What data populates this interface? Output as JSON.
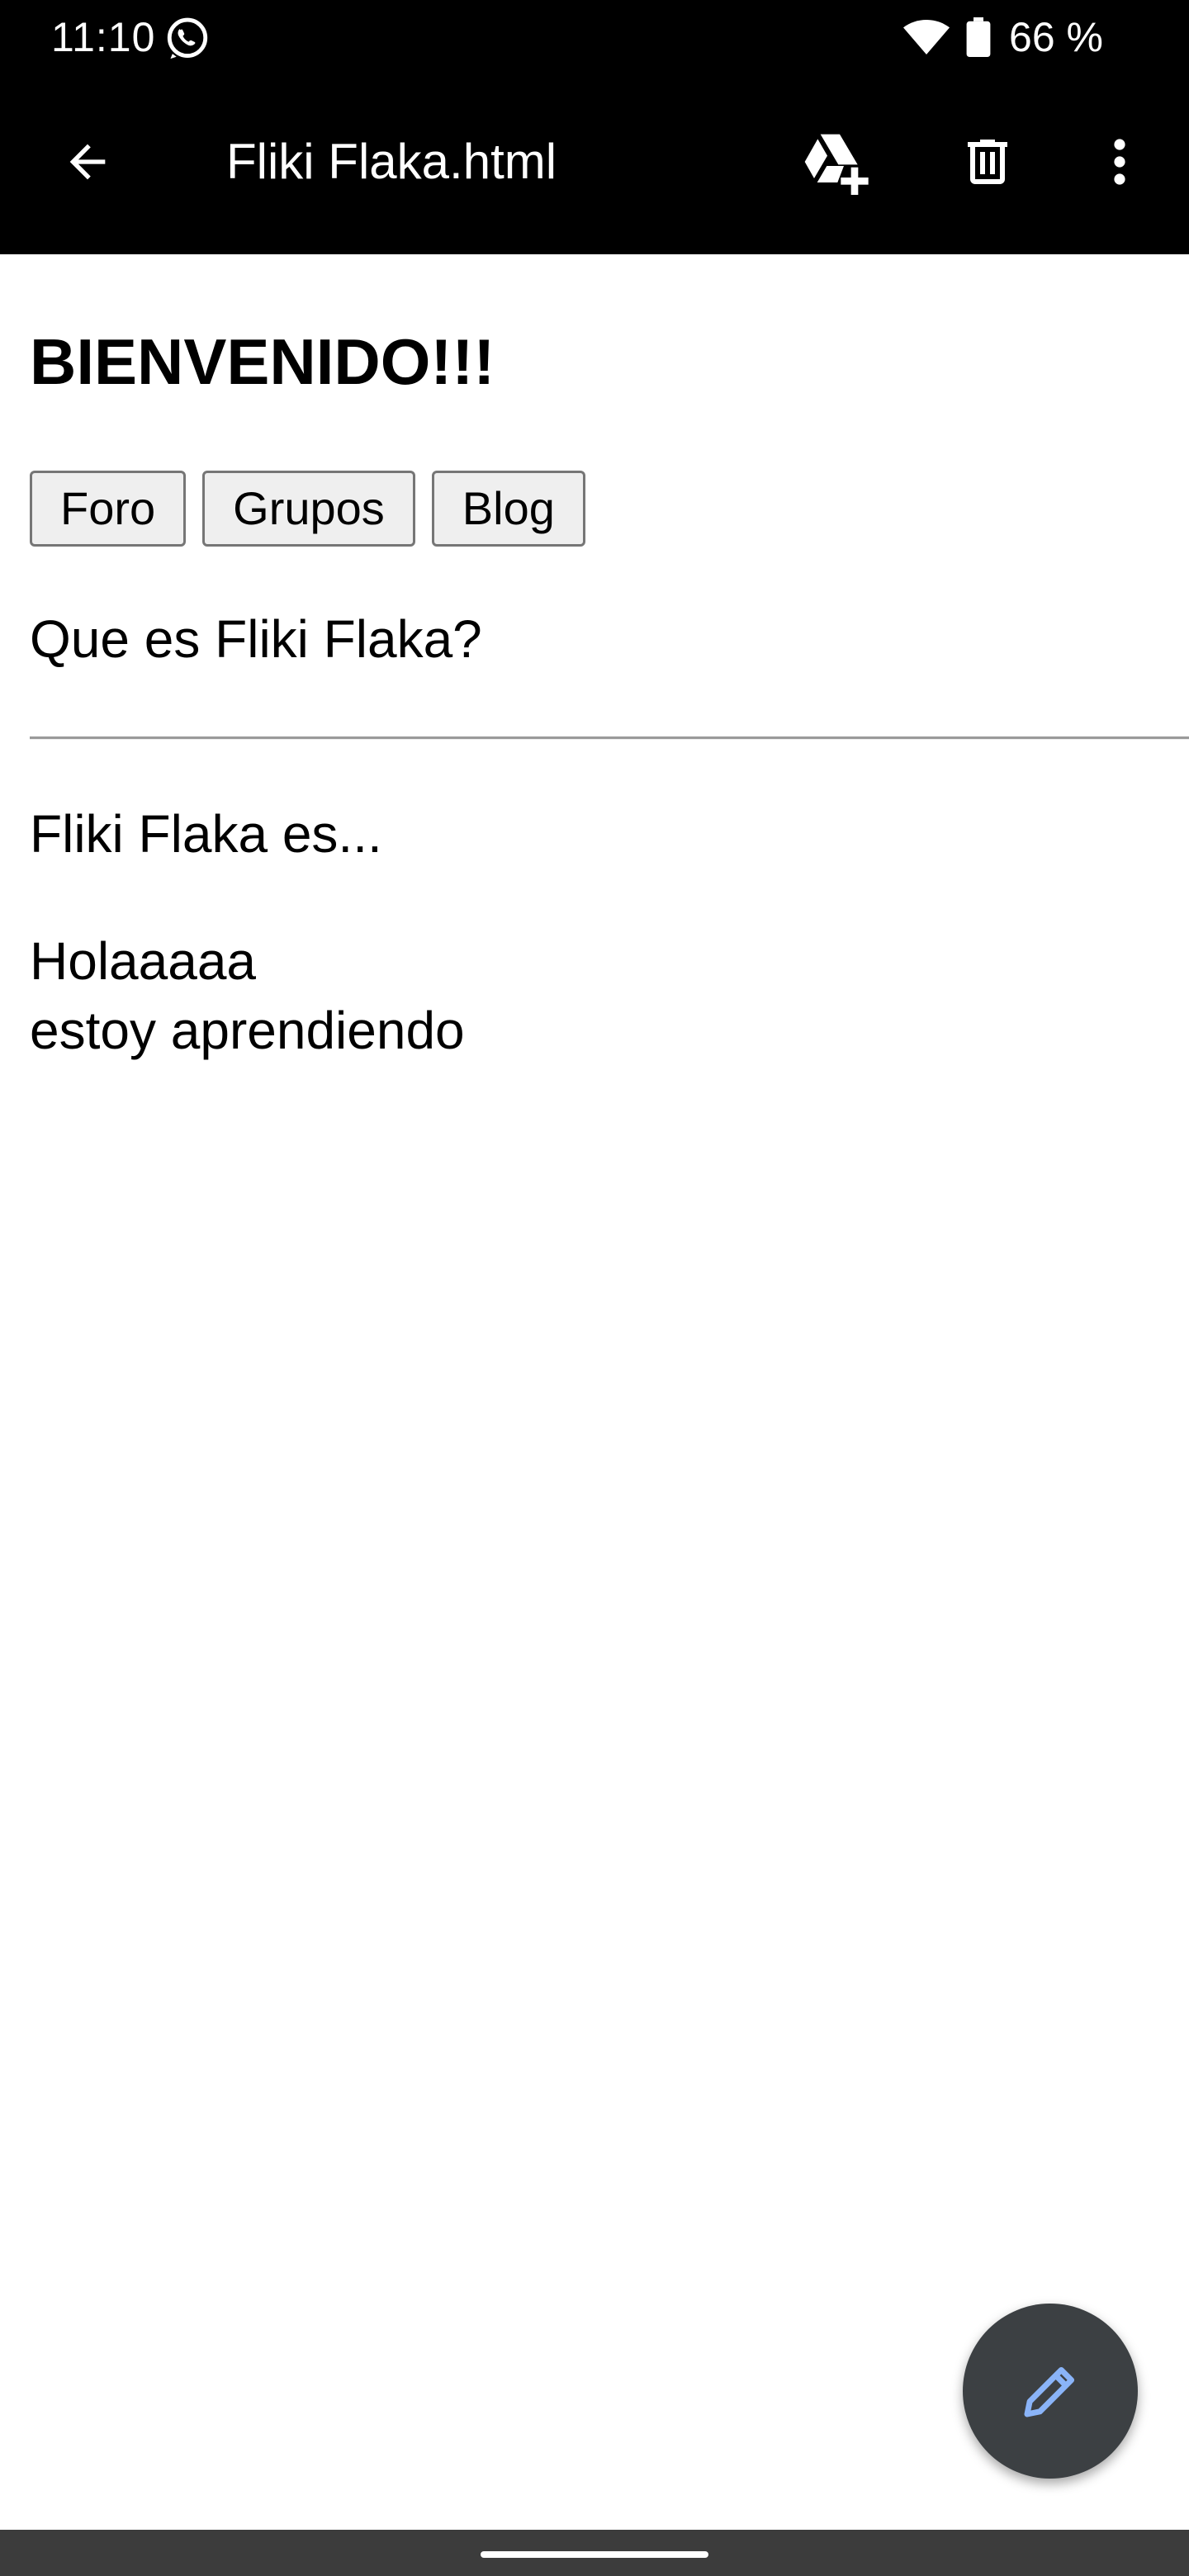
{
  "status_bar": {
    "time": "11:10",
    "battery": "66 %",
    "icons": [
      "whatsapp-icon",
      "wifi-icon",
      "battery-icon"
    ]
  },
  "toolbar": {
    "title": "Fliki Flaka.html",
    "icons": [
      "back-arrow-icon",
      "drive-add-icon",
      "trash-icon",
      "more-vert-icon"
    ]
  },
  "page": {
    "heading": "BIENVENIDO!!!",
    "buttons": [
      "Foro",
      "Grupos",
      "Blog"
    ],
    "question": "Que es Fliki Flaka?",
    "paragraph1": "Fliki Flaka es...",
    "paragraph2_line1": "Holaaaaa",
    "paragraph2_line2": "estoy aprendiendo"
  },
  "fab": {
    "icon": "pencil-edit-icon",
    "icon_color": "#8ab4f8",
    "background": "#3c4043"
  },
  "colors": {
    "bar_background": "#000000",
    "page_background": "#ffffff",
    "nav_bar": "#3c3c3c"
  }
}
